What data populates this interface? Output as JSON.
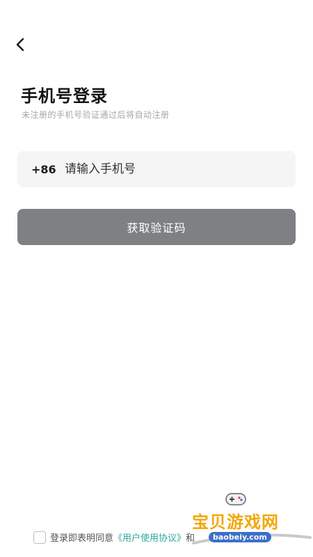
{
  "header": {
    "back_icon": "chevron-left-icon"
  },
  "login": {
    "title": "手机号登录",
    "subtitle": "未注册的手机号验证通过后将自动注册",
    "country_code": "+86",
    "phone_placeholder": "请输入手机号",
    "phone_value": "",
    "submit_label": "获取验证码"
  },
  "agreement": {
    "checked": false,
    "prefix": "登录即表明同意",
    "user_agreement": "《用户使用协议》",
    "connector": "和"
  },
  "watermark": {
    "brand": "宝贝游戏网",
    "url": "baobeiy.com"
  },
  "colors": {
    "button_bg": "#7f8084",
    "input_bg": "#f5f5f5",
    "link": "#2fa8a0",
    "subtitle": "#a6a6a6"
  }
}
